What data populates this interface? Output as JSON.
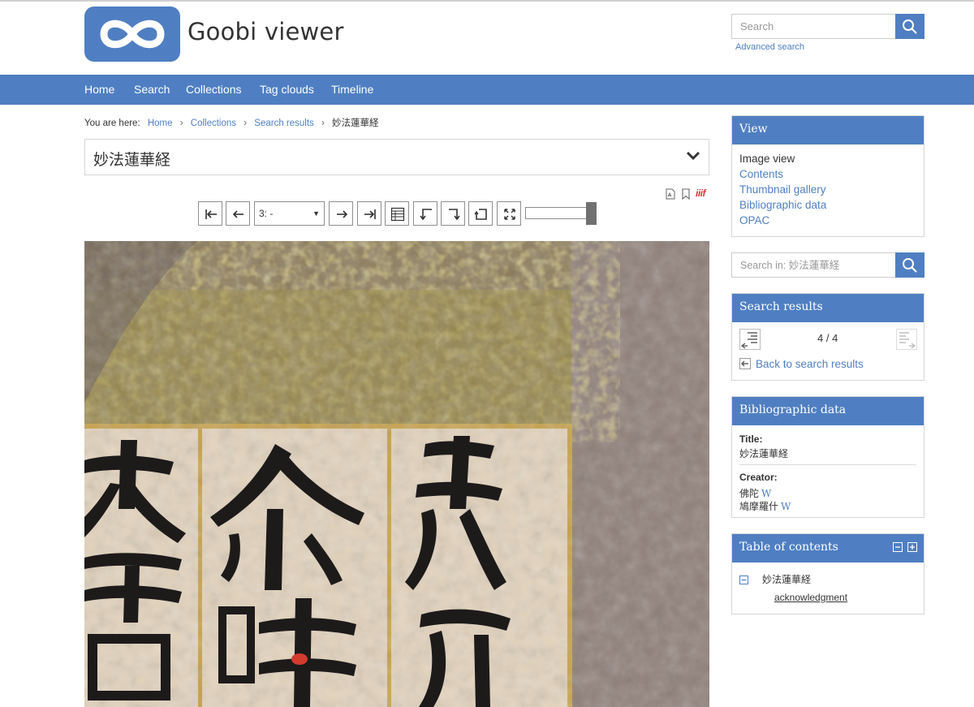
{
  "header": {
    "brand": "Goobi viewer",
    "search_placeholder": "Search",
    "advanced_search": "Advanced search"
  },
  "nav": {
    "items": [
      {
        "label": "Home"
      },
      {
        "label": "Search"
      },
      {
        "label": "Collections"
      },
      {
        "label": "Tag clouds"
      },
      {
        "label": "Timeline"
      }
    ]
  },
  "breadcrumb": {
    "prefix": "You are here:",
    "items": [
      "Home",
      "Collections",
      "Search results"
    ],
    "sep": "›",
    "current": "妙法蓮華経"
  },
  "record": {
    "title": "妙法蓮華経"
  },
  "toolbar": {
    "page_select_value": "3: -",
    "icons": [
      "first-page-icon",
      "previous-page-icon",
      "next-page-icon",
      "last-page-icon",
      "thumbnails-icon",
      "rotate-left-icon",
      "rotate-right-icon",
      "reset-icon",
      "fullscreen-icon"
    ],
    "iiif_label": "iiif"
  },
  "sidebar": {
    "view": {
      "heading": "View",
      "items": [
        {
          "label": "Image view",
          "active": true
        },
        {
          "label": "Contents"
        },
        {
          "label": "Thumbnail gallery"
        },
        {
          "label": "Bibliographic data"
        },
        {
          "label": "OPAC"
        }
      ]
    },
    "search_in_placeholder": "Search in: 妙法蓮華経",
    "search_results": {
      "heading": "Search results",
      "count": "4 / 4",
      "back": "Back to search results"
    },
    "bibliographic": {
      "heading": "Bibliographic data",
      "title_label": "Title:",
      "title_value": "妙法蓮華経",
      "creator_label": "Creator:",
      "creators": [
        "佛陀",
        "鳩摩羅什"
      ],
      "wiki_glyph": "W"
    },
    "toc": {
      "heading": "Table of contents",
      "root": "妙法蓮華経",
      "child": "acknowledgment"
    }
  },
  "colors": {
    "primary": "#4f7fc2",
    "text": "#333333",
    "border": "#d6d6d6",
    "iiif": "#d23b3b"
  }
}
